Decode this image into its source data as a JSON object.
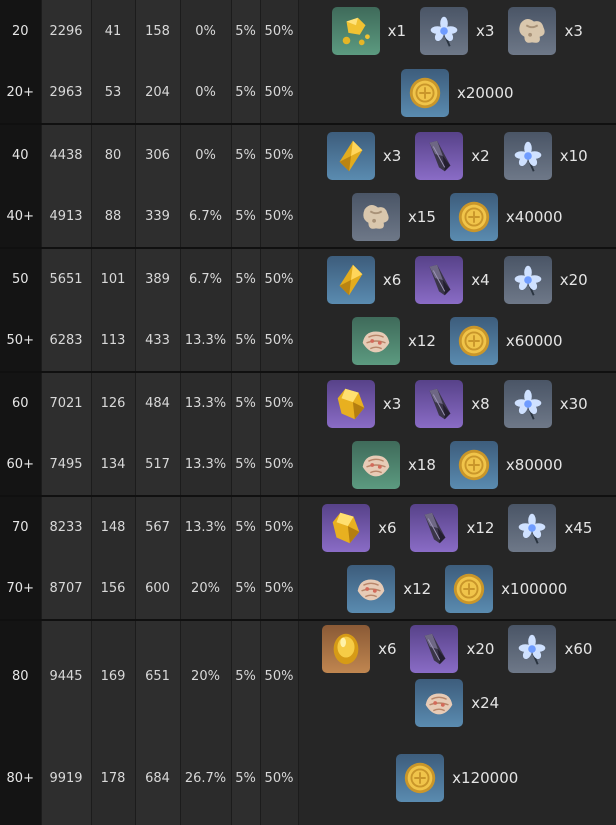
{
  "rows": [
    {
      "level": "20",
      "c1": "2296",
      "c2": "41",
      "c3": "158",
      "c4": "0%",
      "c5": "5%",
      "c6": "50%",
      "materials": [
        {
          "icon": "gold-nugget-icon",
          "bg": "green",
          "qty": "x1"
        },
        {
          "icon": "blue-flower-icon",
          "bg": "gray",
          "qty": "x3"
        },
        {
          "icon": "bone-fragment-icon",
          "bg": "gray",
          "qty": "x3"
        }
      ]
    },
    {
      "level": "20+",
      "c1": "2963",
      "c2": "53",
      "c3": "204",
      "c4": "0%",
      "c5": "5%",
      "c6": "50%",
      "materials": [
        {
          "icon": "coin-icon",
          "bg": "blue",
          "qty": "x20000"
        }
      ]
    },
    {
      "level": "40",
      "c1": "4438",
      "c2": "80",
      "c3": "306",
      "c4": "0%",
      "c5": "5%",
      "c6": "50%",
      "materials": [
        {
          "icon": "gold-shard-icon",
          "bg": "blue",
          "qty": "x3"
        },
        {
          "icon": "dark-crystal-icon",
          "bg": "purple",
          "qty": "x2"
        },
        {
          "icon": "blue-flower-icon",
          "bg": "gray",
          "qty": "x10"
        }
      ]
    },
    {
      "level": "40+",
      "c1": "4913",
      "c2": "88",
      "c3": "339",
      "c4": "6.7%",
      "c5": "5%",
      "c6": "50%",
      "materials": [
        {
          "icon": "bone-fragment-icon",
          "bg": "gray",
          "qty": "x15"
        },
        {
          "icon": "coin-icon",
          "bg": "blue",
          "qty": "x40000"
        }
      ]
    },
    {
      "level": "50",
      "c1": "5651",
      "c2": "101",
      "c3": "389",
      "c4": "6.7%",
      "c5": "5%",
      "c6": "50%",
      "materials": [
        {
          "icon": "gold-shard-icon",
          "bg": "blue",
          "qty": "x6"
        },
        {
          "icon": "dark-crystal-icon",
          "bg": "purple",
          "qty": "x4"
        },
        {
          "icon": "blue-flower-icon",
          "bg": "gray",
          "qty": "x20"
        }
      ]
    },
    {
      "level": "50+",
      "c1": "6283",
      "c2": "113",
      "c3": "433",
      "c4": "13.3%",
      "c5": "5%",
      "c6": "50%",
      "materials": [
        {
          "icon": "shell-icon",
          "bg": "green",
          "qty": "x12"
        },
        {
          "icon": "coin-icon",
          "bg": "blue",
          "qty": "x60000"
        }
      ]
    },
    {
      "level": "60",
      "c1": "7021",
      "c2": "126",
      "c3": "484",
      "c4": "13.3%",
      "c5": "5%",
      "c6": "50%",
      "materials": [
        {
          "icon": "gold-crystal-icon",
          "bg": "purple",
          "qty": "x3"
        },
        {
          "icon": "dark-crystal-icon",
          "bg": "purple",
          "qty": "x8"
        },
        {
          "icon": "blue-flower-icon",
          "bg": "gray",
          "qty": "x30"
        }
      ]
    },
    {
      "level": "60+",
      "c1": "7495",
      "c2": "134",
      "c3": "517",
      "c4": "13.3%",
      "c5": "5%",
      "c6": "50%",
      "materials": [
        {
          "icon": "shell-icon",
          "bg": "green",
          "qty": "x18"
        },
        {
          "icon": "coin-icon",
          "bg": "blue",
          "qty": "x80000"
        }
      ]
    },
    {
      "level": "70",
      "c1": "8233",
      "c2": "148",
      "c3": "567",
      "c4": "13.3%",
      "c5": "5%",
      "c6": "50%",
      "materials": [
        {
          "icon": "gold-crystal-icon",
          "bg": "purple",
          "qty": "x6"
        },
        {
          "icon": "dark-crystal-icon",
          "bg": "purple",
          "qty": "x12"
        },
        {
          "icon": "blue-flower-icon",
          "bg": "gray",
          "qty": "x45"
        }
      ]
    },
    {
      "level": "70+",
      "c1": "8707",
      "c2": "156",
      "c3": "600",
      "c4": "20%",
      "c5": "5%",
      "c6": "50%",
      "materials": [
        {
          "icon": "shell-icon",
          "bg": "blue",
          "qty": "x12"
        },
        {
          "icon": "coin-icon",
          "bg": "blue",
          "qty": "x100000"
        }
      ]
    },
    {
      "level": "80",
      "c1": "9445",
      "c2": "169",
      "c3": "651",
      "c4": "20%",
      "c5": "5%",
      "c6": "50%",
      "materials": [
        {
          "icon": "gold-gem-icon",
          "bg": "orange",
          "qty": "x6"
        },
        {
          "icon": "dark-crystal-icon",
          "bg": "purple",
          "qty": "x20"
        },
        {
          "icon": "blue-flower-icon",
          "bg": "gray",
          "qty": "x60"
        },
        {
          "icon": "shell-icon",
          "bg": "blue",
          "qty": "x24"
        }
      ]
    },
    {
      "level": "80+",
      "c1": "9919",
      "c2": "178",
      "c3": "684",
      "c4": "26.7%",
      "c5": "5%",
      "c6": "50%",
      "materials": [
        {
          "icon": "coin-icon",
          "bg": "blue",
          "qty": "x120000"
        }
      ]
    }
  ]
}
